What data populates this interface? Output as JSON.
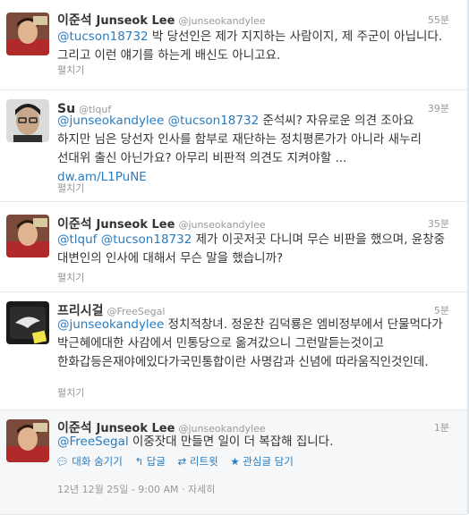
{
  "tweets": [
    {
      "name_ko": "이준석",
      "name_en": "Junseok Lee",
      "screen_name": "@junseokandylee",
      "time": "55분",
      "mention1": "@tucson18732",
      "text": " 박 당선인은 제가 지지하는 사람이지, 제 주군이 아닙니다. 그리고 이런 얘기를 하는게 배신도 아니고요.",
      "expand": "펼치기"
    },
    {
      "name_ko": "Su",
      "screen_name": "@tlquf",
      "time": "39분",
      "mention1": "@junseokandylee",
      "mention2": "@tucson18732",
      "text": " 준석씨? 자유로운 의견 조아요 하지만 님은 당선자 인사를 함부로 재단하는 정치평론가가 아니라 새누리 선대위 출신 아닌가요? 아무리 비판적 의견도 지켜야할 ...",
      "link": "dw.am/L1PuNE",
      "expand": "펼치기"
    },
    {
      "name_ko": "이준석",
      "name_en": "Junseok Lee",
      "screen_name": "@junseokandylee",
      "time": "35분",
      "mention1": "@tlquf",
      "mention2": "@tucson18732",
      "text": " 제가 이곳저곳 다니며 무슨 비판을 했으며, 윤창중 대변인의 인사에 대해서 무슨 말을 했습니까?",
      "expand": "펼치기"
    },
    {
      "name_ko": "프리시걸",
      "screen_name": "@FreeSegal",
      "time": "5분",
      "mention1": "@junseokandylee",
      "text": " 정치적창녀. 정운찬 김덕룡은 엠비정부에서 단물먹다가 박근혜에대한 사감에서 민통당으로 옮겨갔으니 그런말듣는것이고 한화갑등은재야에있다가국민통합이란 사명감과 신념에 따라움직인것인데.",
      "expand": "펼치기"
    },
    {
      "name_ko": "이준석",
      "name_en": "Junseok Lee",
      "screen_name": "@junseokandylee",
      "time": "1분",
      "mention1": "@FreeSegal",
      "text": " 이중잣대 만들면 일이 더 복잡해 집니다.",
      "actions": {
        "hide": "대화 숨기기",
        "reply": "답글",
        "retweet": "리트윗",
        "favorite": "관심글 담기"
      },
      "timestamp": "12년 12월 25일 - 9:00 AM",
      "detail": "자세히"
    }
  ]
}
